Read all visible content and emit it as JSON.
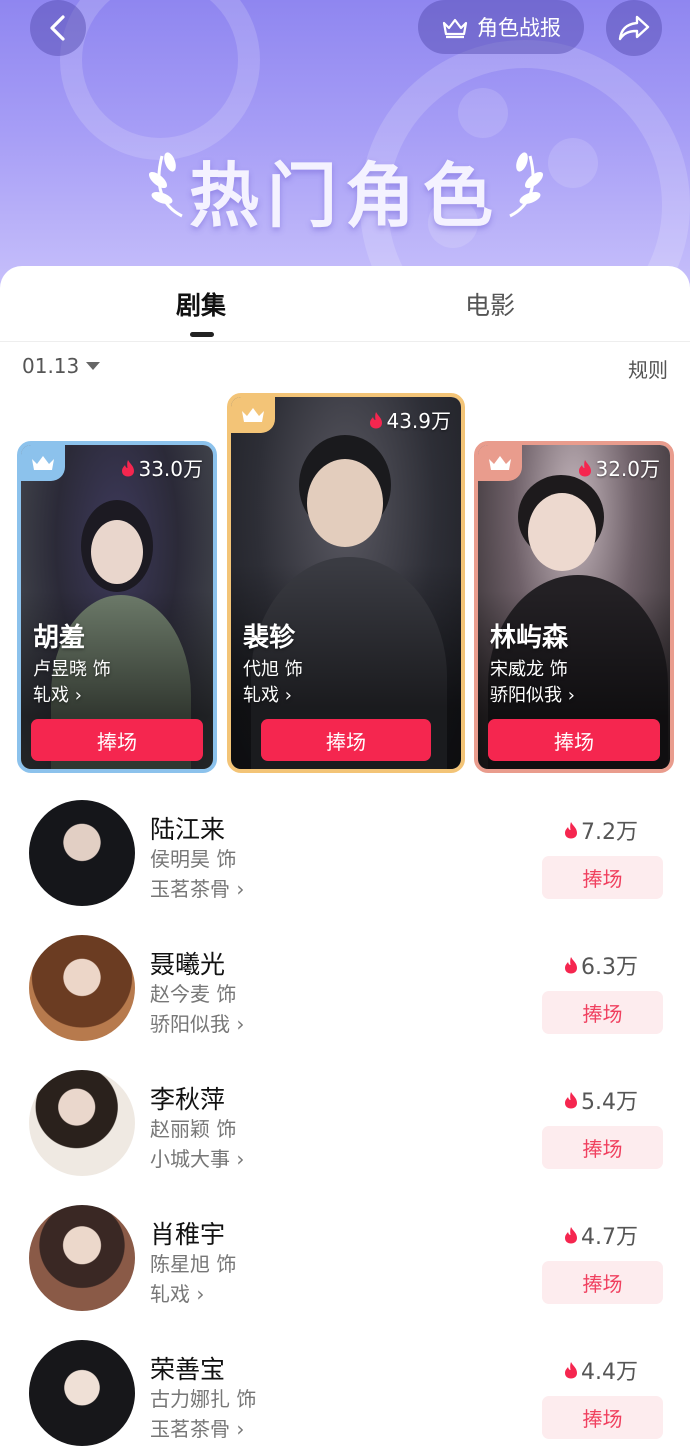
{
  "header": {
    "title": "热门角色",
    "report_label": "角色战报",
    "back_icon": "chevron-left-icon",
    "share_icon": "share-arrow-icon",
    "crown_icon": "crown-icon",
    "gradient_top": "#8f86f0",
    "gradient_bottom": "#c9c2fb"
  },
  "tabs": [
    {
      "label": "剧集",
      "active": true
    },
    {
      "label": "电影",
      "active": false
    }
  ],
  "filter": {
    "date": "01.13",
    "rules_label": "规则"
  },
  "top3": [
    {
      "rank": 2,
      "name": "胡羞",
      "actor": "卢昱晓 饰",
      "show": "轧戏",
      "heat": "33.0万",
      "button": "捧场",
      "border_color": "#8cc2ec"
    },
    {
      "rank": 1,
      "name": "裴轸",
      "actor": "代旭 饰",
      "show": "轧戏",
      "heat": "43.9万",
      "button": "捧场",
      "border_color": "#f3c477"
    },
    {
      "rank": 3,
      "name": "林屿森",
      "actor": "宋威龙 饰",
      "show": "骄阳似我",
      "heat": "32.0万",
      "button": "捧场",
      "border_color": "#e99c8d"
    }
  ],
  "list": [
    {
      "name": "陆江来",
      "actor": "侯明昊 饰",
      "show": "玉茗茶骨",
      "heat": "7.2万",
      "button": "捧场"
    },
    {
      "name": "聂曦光",
      "actor": "赵今麦 饰",
      "show": "骄阳似我",
      "heat": "6.3万",
      "button": "捧场"
    },
    {
      "name": "李秋萍",
      "actor": "赵丽颖 饰",
      "show": "小城大事",
      "heat": "5.4万",
      "button": "捧场"
    },
    {
      "name": "肖稚宇",
      "actor": "陈星旭 饰",
      "show": "轧戏",
      "heat": "4.7万",
      "button": "捧场"
    },
    {
      "name": "荣善宝",
      "actor": "古力娜扎 饰",
      "show": "玉茗茶骨",
      "heat": "4.4万",
      "button": "捧场"
    }
  ],
  "colors": {
    "accent": "#f5264f",
    "button_light_bg": "#fdecee",
    "button_light_text": "#f0405f",
    "flame": "#f5264f"
  }
}
